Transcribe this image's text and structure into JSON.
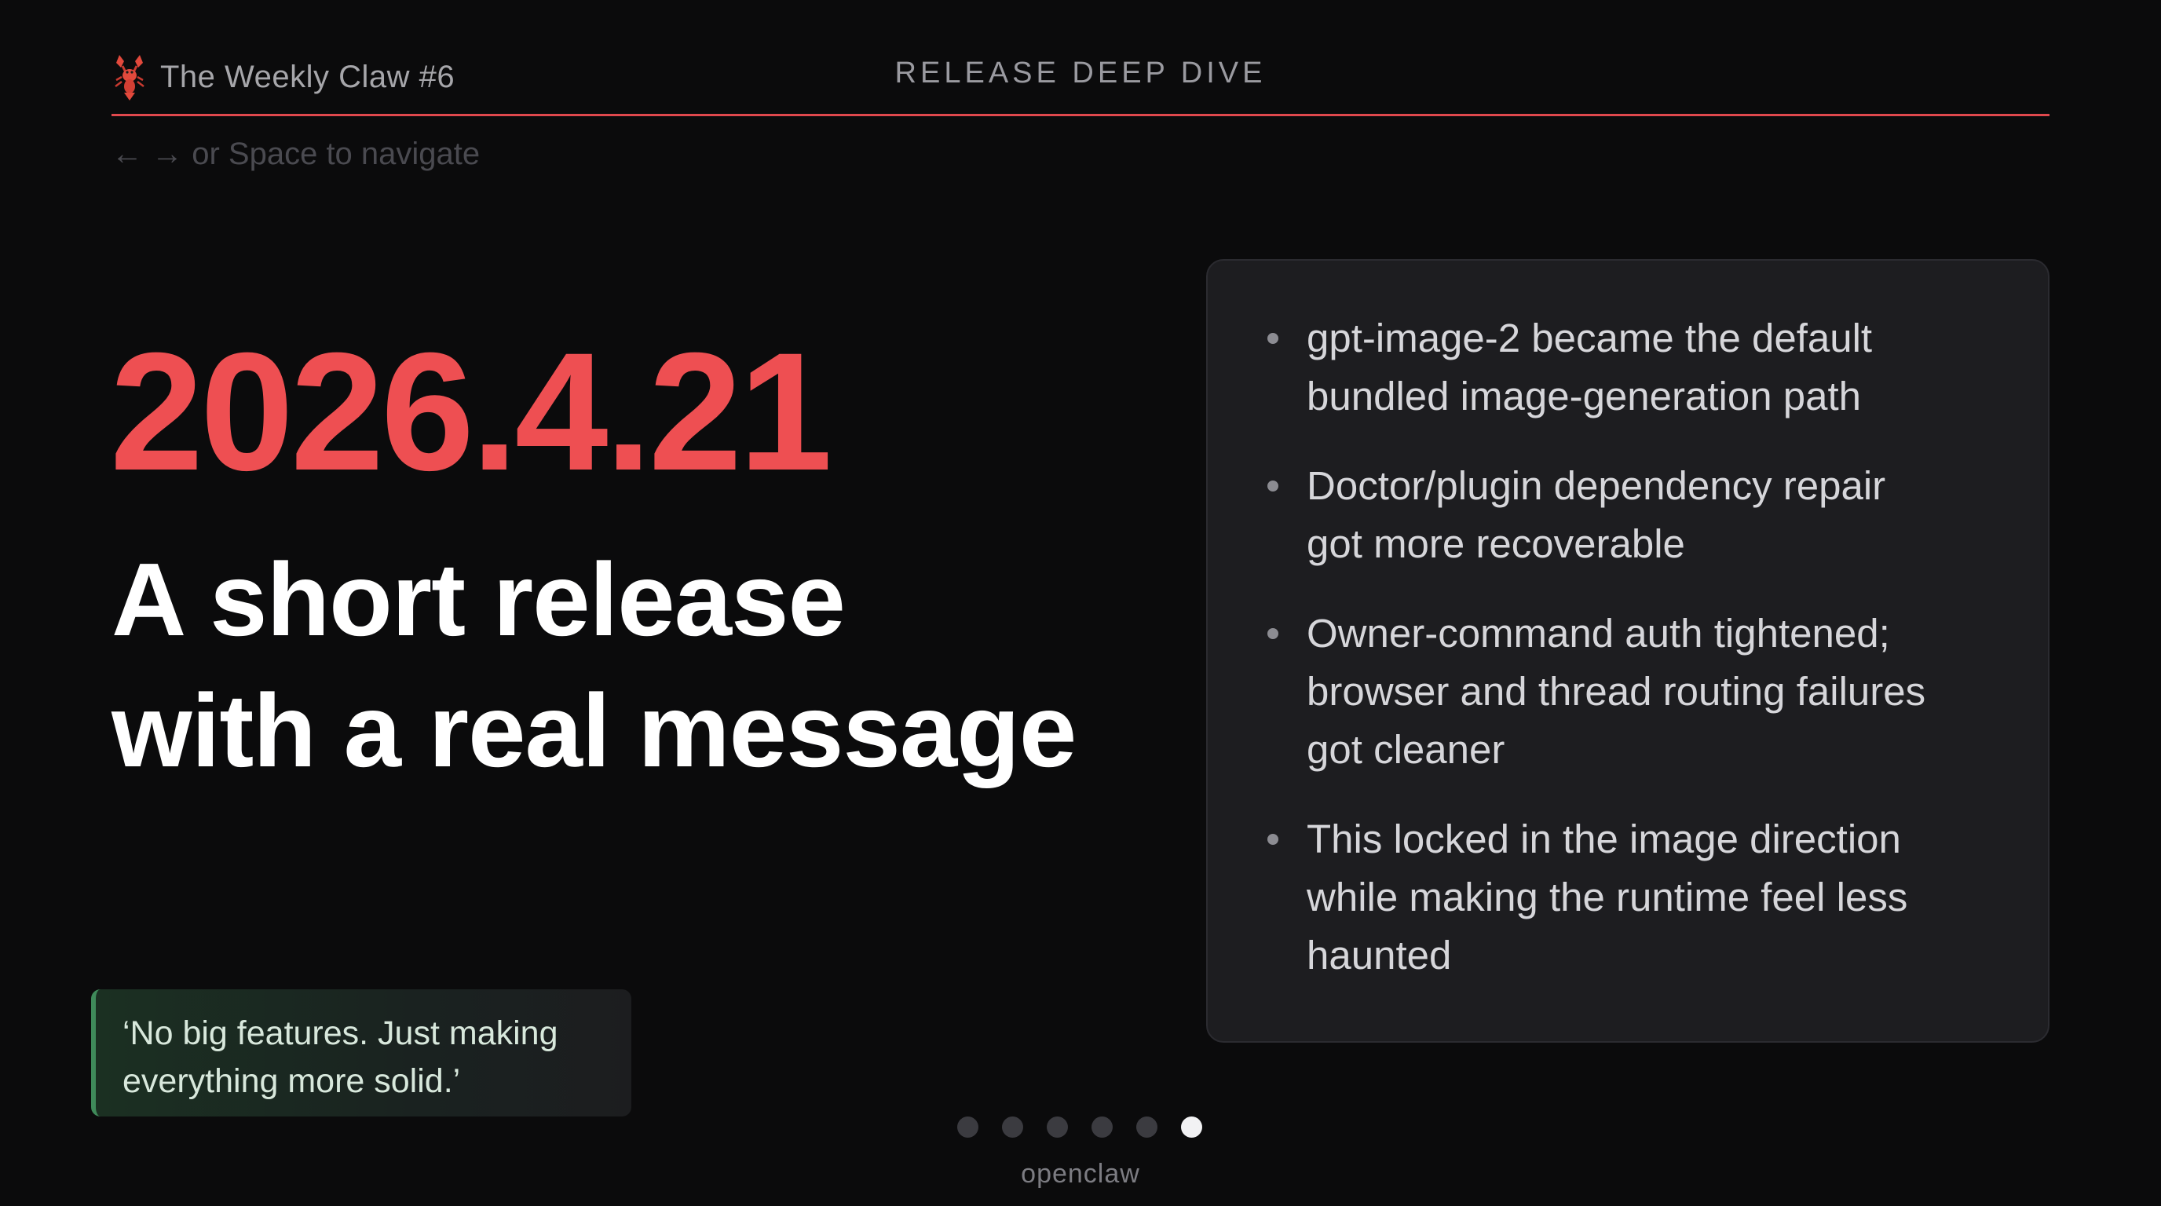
{
  "header": {
    "brand_icon": "lobster-icon",
    "brand_title": "The Weekly Claw #6",
    "section_label": "RELEASE DEEP DIVE",
    "accent_color": "#e0484d"
  },
  "nav_hint": "← → or Space to navigate",
  "slide": {
    "version": "2026.4.21",
    "headline_line1": "A short release",
    "headline_line2": "with a real message",
    "version_color": "#ee4f52",
    "bullets": [
      {
        "line1": "gpt-image-2 became the default",
        "line2": "bundled image-generation path"
      },
      {
        "line1": "Doctor/plugin dependency repair",
        "line2": "got more recoverable"
      },
      {
        "line1": "Owner-command auth tightened;",
        "line2": "browser and thread routing failures",
        "line3": "got cleaner"
      },
      {
        "line1": "This locked in the image direction",
        "line2": "while making the runtime feel less",
        "line3": "haunted"
      }
    ],
    "quote_line1": "‘No big features. Just making",
    "quote_line2": "everything more solid.’",
    "quote_accent_color": "#3f8a5a"
  },
  "pagination": {
    "total": 6,
    "current": 6
  },
  "footer": {
    "brand": "openclaw"
  }
}
